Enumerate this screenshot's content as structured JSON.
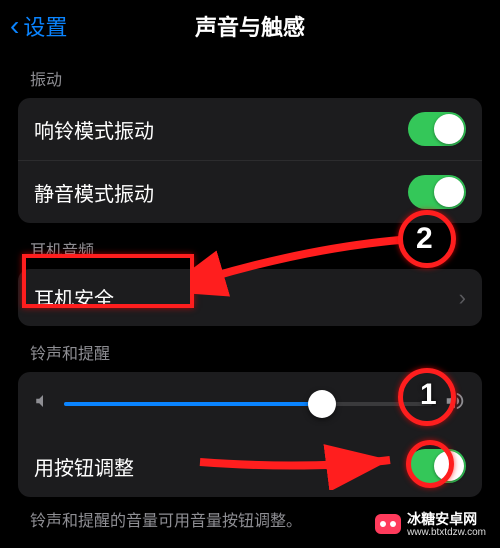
{
  "header": {
    "back_label": "设置",
    "title": "声音与触感"
  },
  "section_vibration": {
    "label": "振动",
    "rows": [
      {
        "label": "响铃模式振动",
        "on": true
      },
      {
        "label": "静音模式振动",
        "on": true
      }
    ]
  },
  "section_headphone": {
    "label": "耳机音频",
    "rows": [
      {
        "label": "耳机安全"
      }
    ]
  },
  "section_ringer": {
    "label": "铃声和提醒",
    "slider_value_percent": 70,
    "rows": [
      {
        "label": "用按钮调整",
        "on": true
      }
    ],
    "footer": "铃声和提醒的音量可用音量按钮调整。"
  },
  "annotations": {
    "step1": "1",
    "step2": "2"
  },
  "watermark": {
    "brand": "冰糖安卓网",
    "url": "www.btxtdzw.com"
  },
  "colors": {
    "accent": "#0a84ff",
    "switch_on": "#34c759",
    "annotation_red": "#ff1e1e"
  }
}
